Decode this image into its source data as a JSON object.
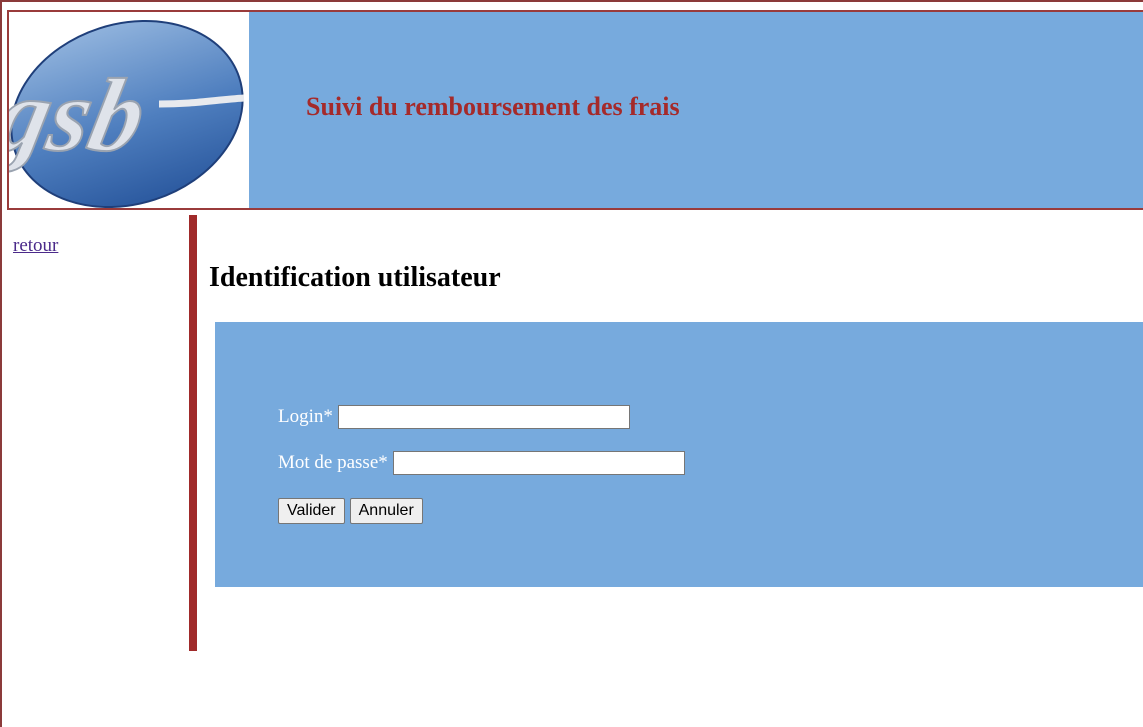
{
  "header": {
    "logo_text": "gsb",
    "title": "Suivi du remboursement des frais"
  },
  "sidebar": {
    "back_link": "retour"
  },
  "main": {
    "title": "Identification utilisateur",
    "form": {
      "login_label": "Login*",
      "login_value": "",
      "password_label": "Mot de passe*",
      "password_value": "",
      "submit_label": "Valider",
      "cancel_label": "Annuler"
    }
  },
  "colors": {
    "accent_blue": "#77aadd",
    "brand_red": "#a52a2a",
    "divider_red": "#a02a2a"
  }
}
